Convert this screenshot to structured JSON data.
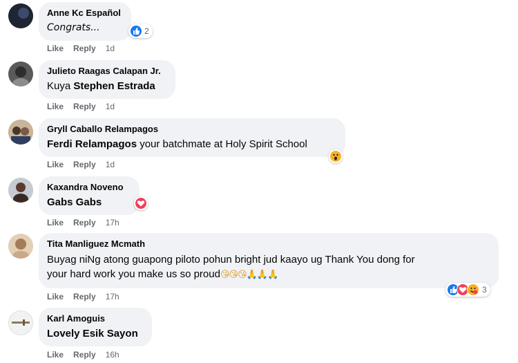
{
  "labels": {
    "like": "Like",
    "reply": "Reply"
  },
  "comments": [
    {
      "author": "Anne Kc Español",
      "text": "Congrats...",
      "time": "1d",
      "reaction_count": "2"
    },
    {
      "author": "Julieto Raagas Calapan Jr.",
      "text_prefix": "Kuya ",
      "mention": "Stephen Estrada",
      "time": "1d"
    },
    {
      "author": "Gryll Caballo Relampagos",
      "mention": "Ferdi Relampagos",
      "text_suffix": " your batchmate at Holy Spirit School",
      "time": "1d"
    },
    {
      "author": "Kaxandra Noveno",
      "mention": "Gabs Gabs",
      "time": "17h"
    },
    {
      "author": "Tita Manliguez Mcmath",
      "text_line1": "Buyag niNg atong guapong piloto pohun bright jud kaayo ug Thank You dong for",
      "text_line2": "your hard work you make us so proud",
      "emoji": "😘😘😘🙏🙏🙏",
      "time": "17h",
      "reaction_count": "3"
    },
    {
      "author": "Karl Amoguis",
      "mention": "Lovely Esik Sayon",
      "time": "16h"
    }
  ]
}
